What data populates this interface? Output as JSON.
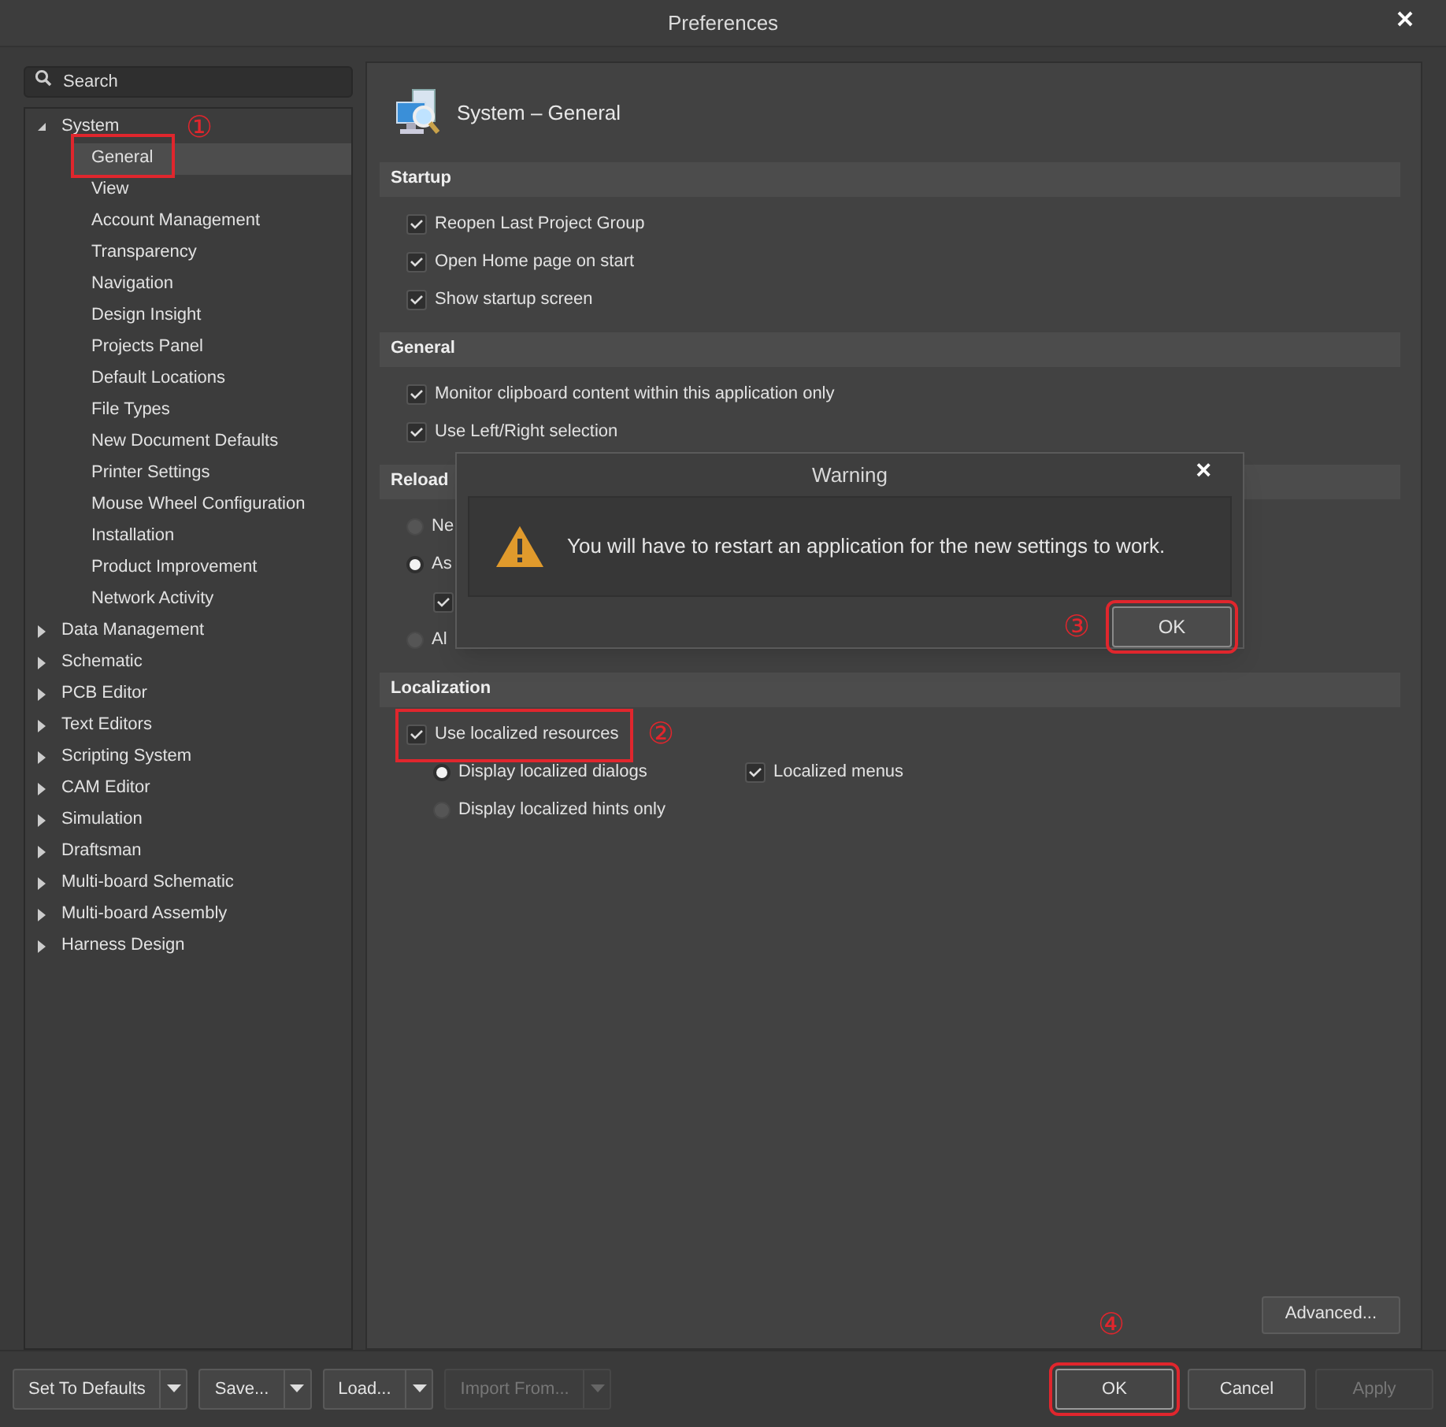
{
  "window": {
    "title": "Preferences"
  },
  "search": {
    "placeholder": "Search"
  },
  "tree": [
    {
      "label": "System",
      "expanded": true,
      "children": [
        {
          "label": "General",
          "selected": true,
          "annotation": "①"
        },
        {
          "label": "View",
          "selected": false
        },
        {
          "label": "Account Management",
          "selected": false
        },
        {
          "label": "Transparency",
          "selected": false
        },
        {
          "label": "Navigation",
          "selected": false
        },
        {
          "label": "Design Insight",
          "selected": false
        },
        {
          "label": "Projects Panel",
          "selected": false
        },
        {
          "label": "Default Locations",
          "selected": false
        },
        {
          "label": "File Types",
          "selected": false
        },
        {
          "label": "New Document Defaults",
          "selected": false
        },
        {
          "label": "Printer Settings",
          "selected": false
        },
        {
          "label": "Mouse Wheel Configuration",
          "selected": false
        },
        {
          "label": "Installation",
          "selected": false
        },
        {
          "label": "Product Improvement",
          "selected": false
        },
        {
          "label": "Network Activity",
          "selected": false
        }
      ]
    },
    {
      "label": "Data Management",
      "expanded": false
    },
    {
      "label": "Schematic",
      "expanded": false
    },
    {
      "label": "PCB Editor",
      "expanded": false
    },
    {
      "label": "Text Editors",
      "expanded": false
    },
    {
      "label": "Scripting System",
      "expanded": false
    },
    {
      "label": "CAM Editor",
      "expanded": false
    },
    {
      "label": "Simulation",
      "expanded": false
    },
    {
      "label": "Draftsman",
      "expanded": false
    },
    {
      "label": "Multi-board Schematic",
      "expanded": false
    },
    {
      "label": "Multi-board Assembly",
      "expanded": false
    },
    {
      "label": "Harness Design",
      "expanded": false
    }
  ],
  "page": {
    "title": "System – General",
    "sections": [
      {
        "title": "Startup",
        "items": [
          {
            "kind": "checkbox",
            "label": "Reopen Last Project Group",
            "checked": true
          },
          {
            "kind": "checkbox",
            "label": "Open Home page on start",
            "checked": true
          },
          {
            "kind": "checkbox",
            "label": "Show startup screen",
            "checked": true
          }
        ]
      },
      {
        "title": "General",
        "items": [
          {
            "kind": "checkbox",
            "label": "Monitor clipboard content within this application only",
            "checked": true
          },
          {
            "kind": "checkbox",
            "label": "Use Left/Right selection",
            "checked": true
          }
        ]
      },
      {
        "title": "Reload",
        "items": [
          {
            "kind": "radio",
            "label": "Ne",
            "selected": false
          },
          {
            "kind": "radio",
            "label": "As",
            "selected": true,
            "children": [
              {
                "kind": "checkbox",
                "checked": true
              }
            ]
          },
          {
            "kind": "radio",
            "label": "Al",
            "selected": false
          }
        ]
      },
      {
        "title": "Localization",
        "items": [
          {
            "kind": "checkbox",
            "label": "Use localized resources",
            "checked": true,
            "annotation": "②",
            "children": [
              {
                "kind": "radio",
                "label": "Display localized dialogs",
                "selected": true,
                "side": {
                  "kind": "checkbox",
                  "label": "Localized menus",
                  "checked": true
                }
              },
              {
                "kind": "radio",
                "label": "Display localized hints only",
                "selected": false
              }
            ]
          }
        ]
      }
    ],
    "advanced_button": "Advanced..."
  },
  "dialog": {
    "title": "Warning",
    "close": "×",
    "message": "You will have to restart an application for the new settings to work.",
    "ok": {
      "label": "OK",
      "annotation": "③"
    }
  },
  "footer": {
    "left": [
      {
        "label": "Set To Defaults",
        "disabled": false
      },
      {
        "label": "Save...",
        "disabled": false
      },
      {
        "label": "Load...",
        "disabled": false
      },
      {
        "label": "Import From...",
        "disabled": true
      }
    ],
    "right": [
      {
        "label": "OK",
        "disabled": false,
        "annotation": "④"
      },
      {
        "label": "Cancel",
        "disabled": false
      },
      {
        "label": "Apply",
        "disabled": true
      }
    ]
  }
}
